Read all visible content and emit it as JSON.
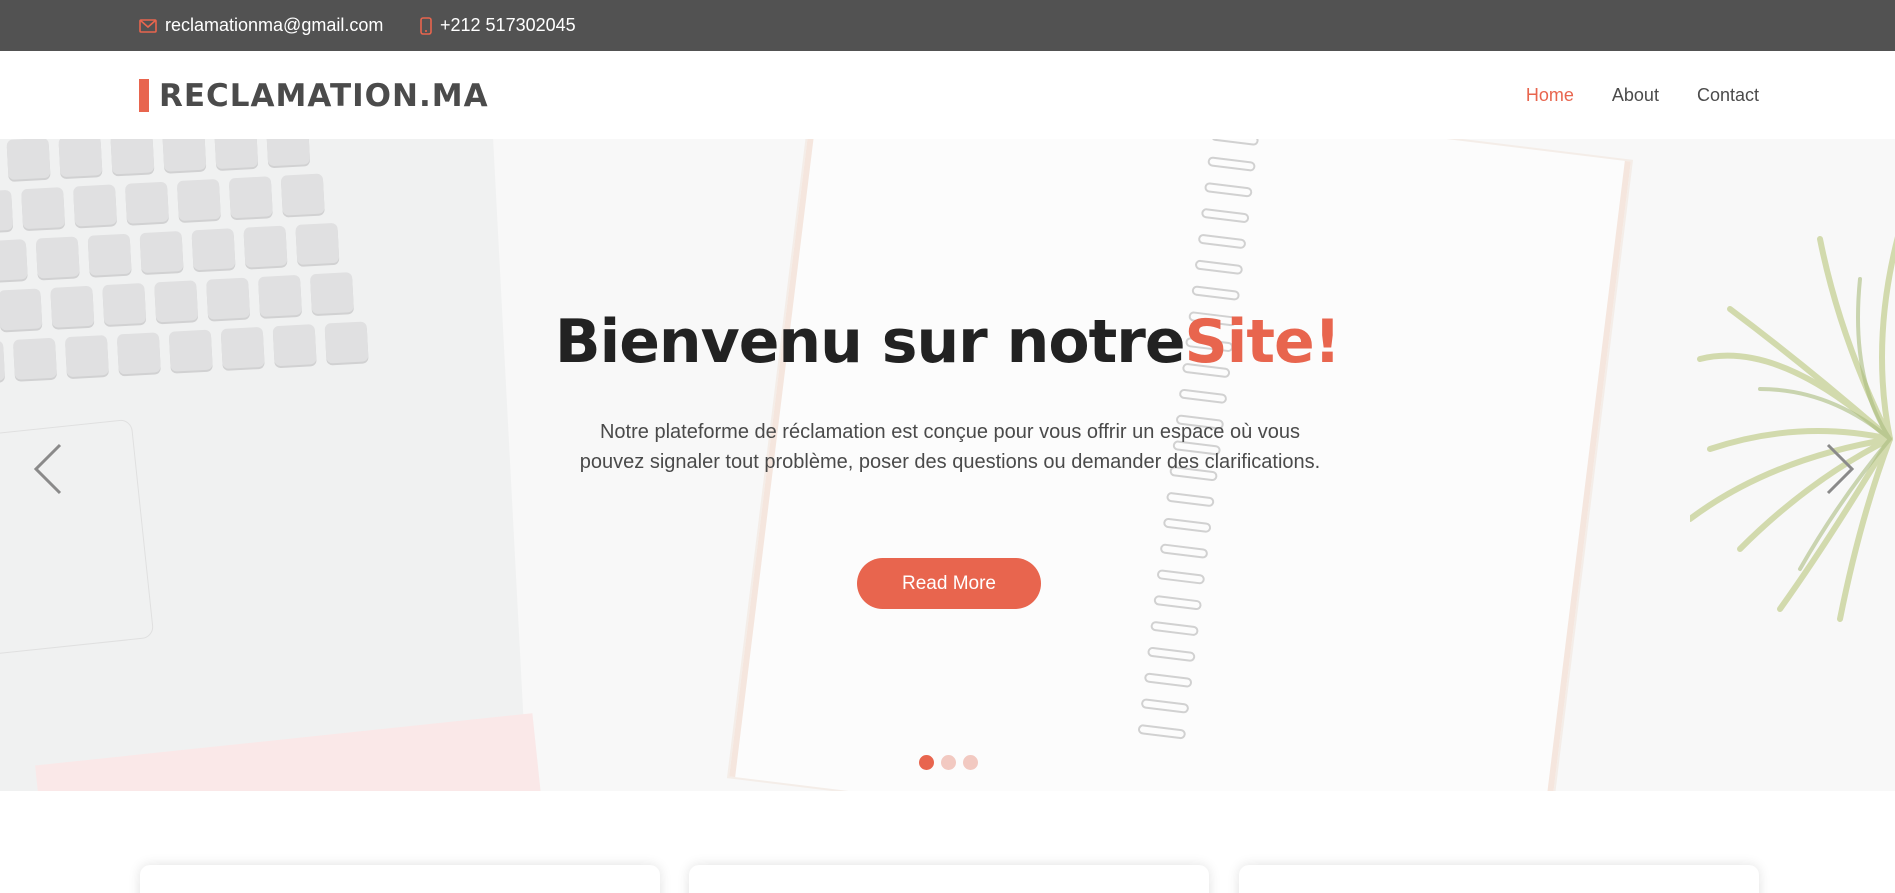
{
  "topbar": {
    "email": "reclamationma@gmail.com",
    "email_icon": "envelope-icon",
    "phone": "+212 517302045",
    "phone_icon": "mobile-phone-icon"
  },
  "navbar": {
    "logo": "RECLAMATION.MA",
    "links": [
      {
        "label": "Home",
        "active": true
      },
      {
        "label": "About",
        "active": false
      },
      {
        "label": "Contact",
        "active": false
      }
    ]
  },
  "hero": {
    "title_main": "Bienvenu sur notre",
    "title_accent": "Site!",
    "description": "Notre plateforme de réclamation est conçue pour vous offrir un espace où vous pouvez signaler tout problème, poser des questions ou demander des clarifications.",
    "button_label": "Read More",
    "prev_icon": "chevron-left-icon",
    "next_icon": "chevron-right-icon",
    "slides": {
      "count": 3,
      "active_index": 0
    }
  },
  "colors": {
    "accent": "#e8654e",
    "topbar_bg": "#525252",
    "text_dark": "#222222"
  }
}
